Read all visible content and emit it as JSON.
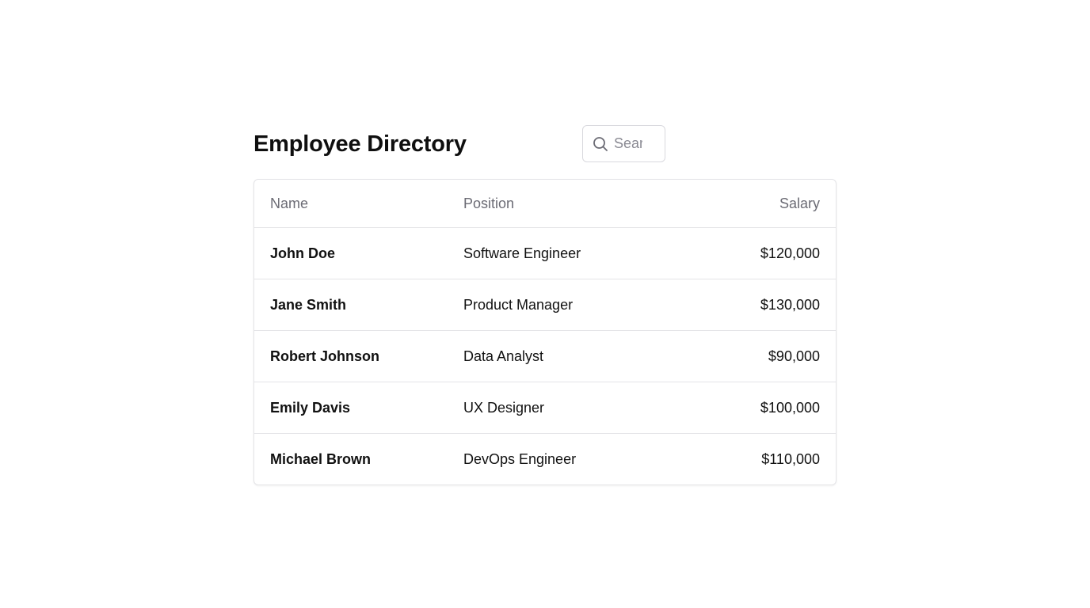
{
  "header": {
    "title": "Employee Directory"
  },
  "search": {
    "placeholder": "Search",
    "icon": "search-icon"
  },
  "table": {
    "columns": {
      "name": "Name",
      "position": "Position",
      "salary": "Salary"
    },
    "rows": [
      {
        "name": "John Doe",
        "position": "Software Engineer",
        "salary": "$120,000"
      },
      {
        "name": "Jane Smith",
        "position": "Product Manager",
        "salary": "$130,000"
      },
      {
        "name": "Robert Johnson",
        "position": "Data Analyst",
        "salary": "$90,000"
      },
      {
        "name": "Emily Davis",
        "position": "UX Designer",
        "salary": "$100,000"
      },
      {
        "name": "Michael Brown",
        "position": "DevOps Engineer",
        "salary": "$110,000"
      }
    ]
  }
}
